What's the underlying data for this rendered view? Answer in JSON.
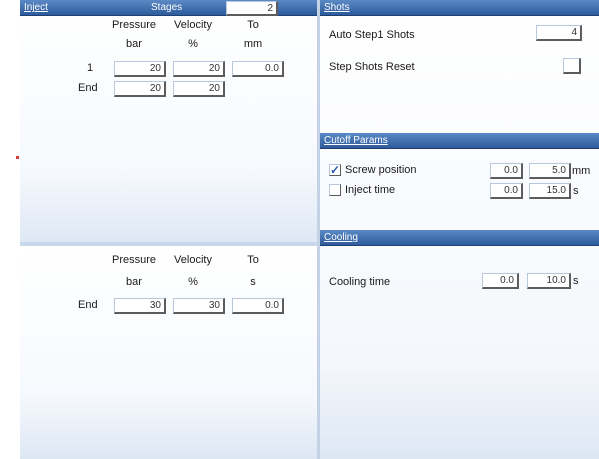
{
  "inject": {
    "title": "Inject",
    "stages_label": "Stages",
    "stages_value": "2",
    "upper_table": {
      "headers": [
        "Pressure",
        "Velocity",
        "To"
      ],
      "units": [
        "bar",
        "%",
        "mm"
      ],
      "rows": [
        {
          "label": "1",
          "values": [
            "20",
            "20",
            "0.0"
          ]
        },
        {
          "label": "End",
          "values": [
            "20",
            "20"
          ]
        }
      ]
    },
    "lower_table": {
      "headers": [
        "Pressure",
        "Velocity",
        "To"
      ],
      "units": [
        "bar",
        "%",
        "s"
      ],
      "rows": [
        {
          "label": "End",
          "values": [
            "30",
            "30",
            "0.0"
          ]
        }
      ]
    }
  },
  "shots": {
    "title": "Shots",
    "auto_step_label": "Auto Step1 Shots",
    "auto_step_value": "4",
    "step_reset_label": "Step Shots Reset"
  },
  "cutoff": {
    "title": "Cutoff Params",
    "screw_label": "Screw position",
    "screw_checked": true,
    "screw_actual": "0.0",
    "screw_set": "5.0",
    "screw_unit": "mm",
    "inject_time_label": "Inject time",
    "inject_time_checked": false,
    "inject_time_actual": "0.0",
    "inject_time_set": "15.0",
    "inject_time_unit": "s"
  },
  "cooling": {
    "title": "Cooling",
    "time_label": "Cooling time",
    "time_actual": "0.0",
    "time_set": "10.0",
    "time_unit": "s"
  }
}
